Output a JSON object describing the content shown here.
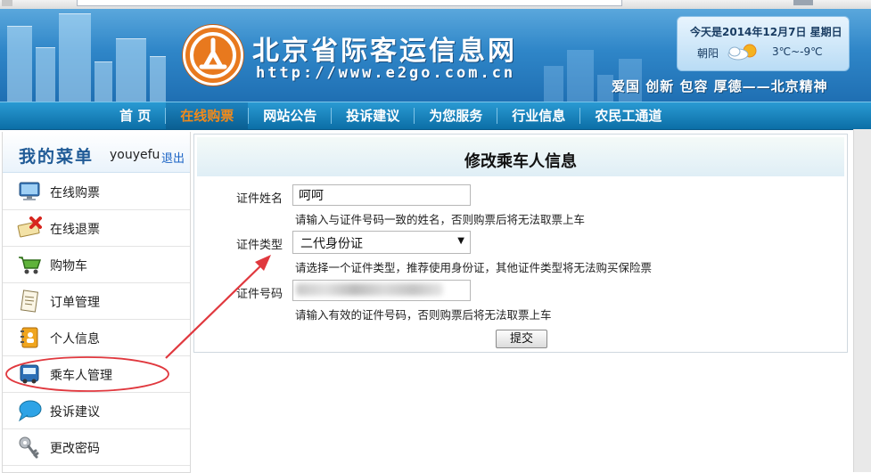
{
  "header": {
    "site_name": "北京省际客运信息网",
    "site_url": "http://www.e2go.com.cn",
    "weather": {
      "date": "今天是2014年12月7日 星期日",
      "city": "朝阳",
      "temp": "3℃~-9℃",
      "icon": "cloud-sun-icon"
    },
    "slogan": "爱国  创新  包容  厚德——北京精神"
  },
  "nav": {
    "items": [
      {
        "label": "首  页"
      },
      {
        "label": "在线购票"
      },
      {
        "label": "网站公告"
      },
      {
        "label": "投诉建议"
      },
      {
        "label": "为您服务"
      },
      {
        "label": "行业信息"
      },
      {
        "label": "农民工通道"
      }
    ],
    "active_index": 1,
    "active_color": "#f28a1a"
  },
  "sidebar": {
    "title": "我的菜单",
    "username": "youyefu",
    "logout": "退出",
    "items": [
      {
        "label": "在线购票",
        "icon": "monitor-icon"
      },
      {
        "label": "在线退票",
        "icon": "ticket-cancel-icon"
      },
      {
        "label": "购物车",
        "icon": "shopping-cart-icon"
      },
      {
        "label": "订单管理",
        "icon": "document-icon"
      },
      {
        "label": "个人信息",
        "icon": "address-book-icon"
      },
      {
        "label": "乘车人管理",
        "icon": "bus-icon"
      },
      {
        "label": "投诉建议",
        "icon": "speech-bubble-icon"
      },
      {
        "label": "更改密码",
        "icon": "key-icon"
      }
    ]
  },
  "form": {
    "title": "修改乘车人信息",
    "name_label": "证件姓名",
    "name_value": "呵呵",
    "name_hint": "请输入与证件号码一致的姓名，否则购票后将无法取票上车",
    "type_label": "证件类型",
    "type_value": "二代身份证",
    "type_hint": "请选择一个证件类型，推荐使用身份证，其他证件类型将无法购买保险票",
    "number_label": "证件号码",
    "number_hint": "请输入有效的证件号码，否则购票后将无法取票上车",
    "submit_label": "提交"
  },
  "annotation": {
    "color": "#e0383e"
  }
}
